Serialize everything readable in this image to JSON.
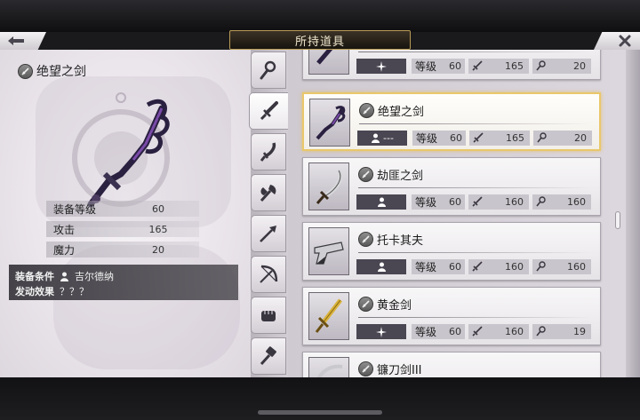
{
  "header": {
    "title": "所持道具"
  },
  "selected_weapon": {
    "name": "绝望之剑",
    "stats": [
      {
        "label": "装备等级",
        "value": "60"
      },
      {
        "label": "攻击",
        "value": "165"
      },
      {
        "label": "魔力",
        "value": "20"
      }
    ],
    "condition_label": "装备条件",
    "condition_value": "吉尔德纳",
    "effect_label": "发动效果",
    "effect_value": "？？？"
  },
  "tabs": [
    {
      "icon": "staff-icon",
      "active": false
    },
    {
      "icon": "sword-icon",
      "active": true
    },
    {
      "icon": "dagger-icon",
      "active": false
    },
    {
      "icon": "axe-icon",
      "active": false
    },
    {
      "icon": "spear-icon",
      "active": false
    },
    {
      "icon": "bow-icon",
      "active": false
    },
    {
      "icon": "fist-icon",
      "active": false
    },
    {
      "icon": "hammer-icon",
      "active": false
    }
  ],
  "level_label": "等级",
  "items": [
    {
      "name": "",
      "type": "magic",
      "type_text": "",
      "level": "60",
      "attack": "165",
      "magic": "20",
      "selected": false
    },
    {
      "name": "绝望之剑",
      "type": "character",
      "type_text": "---",
      "level": "60",
      "attack": "165",
      "magic": "20",
      "selected": true
    },
    {
      "name": "劫匪之剑",
      "type": "character",
      "type_text": "",
      "level": "60",
      "attack": "160",
      "magic": "160",
      "selected": false
    },
    {
      "name": "托卡其夫",
      "type": "character",
      "type_text": "",
      "level": "60",
      "attack": "160",
      "magic": "160",
      "selected": false
    },
    {
      "name": "黄金剑",
      "type": "magic",
      "type_text": "",
      "level": "60",
      "attack": "160",
      "magic": "19",
      "selected": false
    },
    {
      "name": "镰刀剑III",
      "type": "",
      "type_text": "",
      "level": "",
      "attack": "",
      "magic": "",
      "selected": false
    }
  ],
  "colors": {
    "selected_border": "#e9c76b",
    "chip_dark": "#4a4652",
    "title_gold": "#b89a55"
  }
}
